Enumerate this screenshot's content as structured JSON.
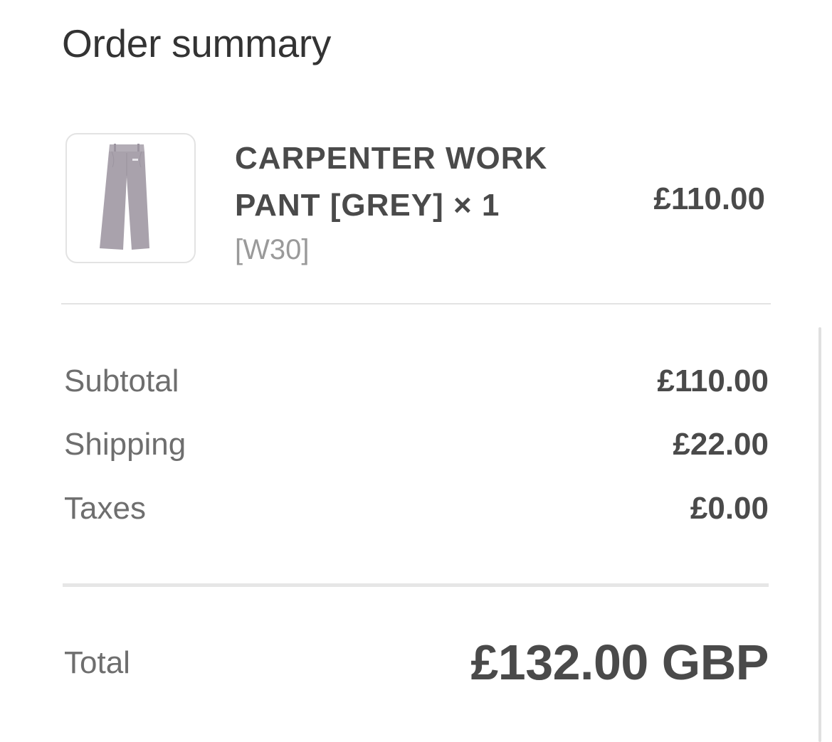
{
  "summary": {
    "title": "Order summary"
  },
  "line_item": {
    "title_line1": "CARPENTER WORK",
    "title_line2": "PANT [GREY] × 1",
    "variant": "[W30]",
    "price": "£110.00",
    "thumbnail_icon": "grey-work-pants-image",
    "thumbnail_color": "#a9a2ac"
  },
  "totals": {
    "subtotal_label": "Subtotal",
    "subtotal_value": "£110.00",
    "shipping_label": "Shipping",
    "shipping_value": "£22.00",
    "taxes_label": "Taxes",
    "taxes_value": "£0.00",
    "total_label": "Total",
    "total_value": "£132.00 GBP"
  }
}
